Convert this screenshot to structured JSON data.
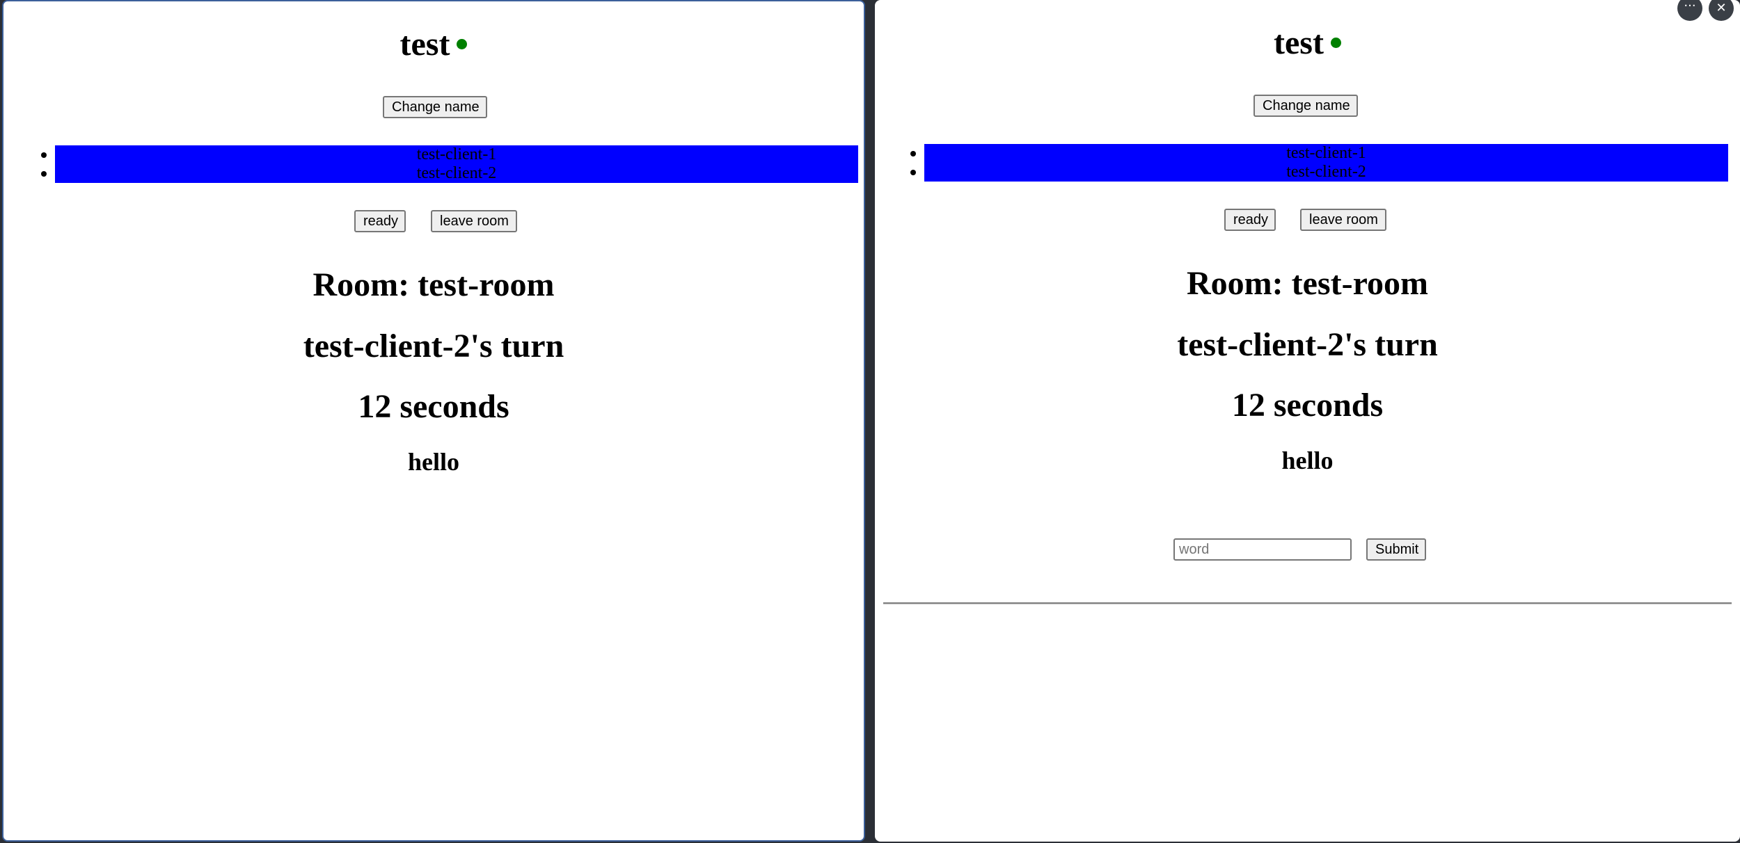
{
  "left_window": {
    "app_title": "test",
    "status_color": "#008000",
    "change_name_label": "Change name",
    "players": [
      "test-client-1",
      "test-client-2"
    ],
    "players_highlight_color": "#0000ff",
    "ready_label": "ready",
    "leave_room_label": "leave room",
    "room_label": "Room: test-room",
    "turn_label": "test-client-2's turn",
    "timer_label": "12 seconds",
    "current_word": "hello"
  },
  "right_window": {
    "app_title": "test",
    "status_color": "#008000",
    "change_name_label": "Change name",
    "players": [
      "test-client-1",
      "test-client-2"
    ],
    "players_highlight_color": "#0000ff",
    "ready_label": "ready",
    "leave_room_label": "leave room",
    "room_label": "Room: test-room",
    "turn_label": "test-client-2's turn",
    "timer_label": "12 seconds",
    "current_word": "hello",
    "word_input": {
      "value": "",
      "placeholder": "word"
    },
    "submit_label": "Submit",
    "window_controls": {
      "more_icon": "more-horizontal-icon",
      "more_glyph": "···",
      "close_icon": "close-icon",
      "close_glyph": "✕"
    }
  }
}
